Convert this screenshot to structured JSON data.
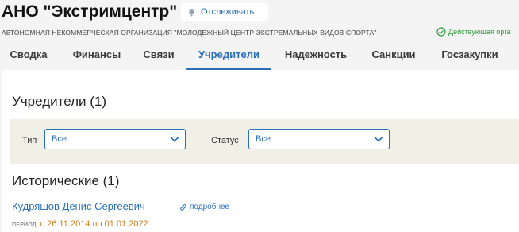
{
  "header": {
    "title": "АНО \"Экстримцентр\"",
    "follow_label": "Отслеживать",
    "full_name": "АВТОНОМНАЯ НЕКОММЕРЧЕСКАЯ ОРГАНИЗАЦИЯ \"МОЛОДЕЖНЫЙ ЦЕНТР ЭКСТРЕМАЛЬНЫХ ВИДОВ СПОРТА\"",
    "status": "Действующая орга"
  },
  "tabs": [
    {
      "label": "Сводка",
      "active": false
    },
    {
      "label": "Финансы",
      "active": false
    },
    {
      "label": "Связи",
      "active": false
    },
    {
      "label": "Учредители",
      "active": true
    },
    {
      "label": "Надежность",
      "active": false
    },
    {
      "label": "Санкции",
      "active": false
    },
    {
      "label": "Госзакупки",
      "active": false
    }
  ],
  "founders": {
    "title": "Учредители (1)",
    "filters": {
      "type_label": "Тип",
      "type_value": "Все",
      "status_label": "Статус",
      "status_value": "Все"
    }
  },
  "historical": {
    "title": "Исторические (1)",
    "person": {
      "name": "Кудряшов Денис Сергеевич",
      "more": "подробнее",
      "period_label": "ПЕРИОД",
      "period_value": "с 26.11.2014 по 01.01.2022"
    }
  },
  "colors": {
    "accent": "#2a6fb8",
    "status_green": "#2e9a3c",
    "period_orange": "#d07e1a",
    "filter_bg": "#f1f0e6"
  },
  "icons": {
    "follow": "bell-icon",
    "status": "check-circle-icon",
    "more": "link-icon",
    "dropdown": "chevron-down-icon"
  }
}
